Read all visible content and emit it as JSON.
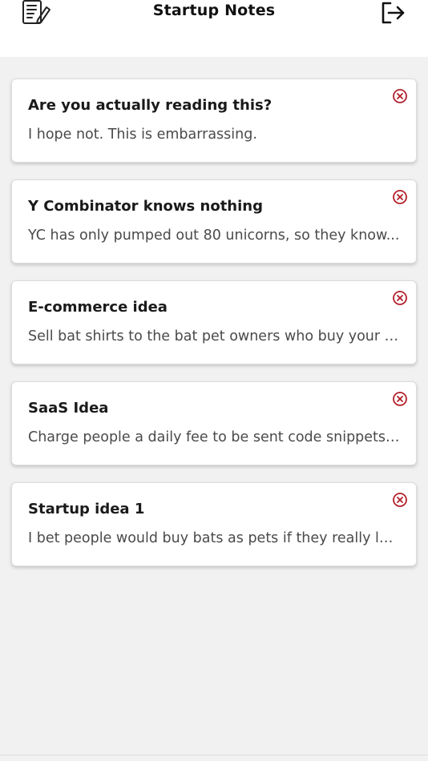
{
  "header": {
    "title": "Startup Notes",
    "logo_icon": "notepad-pencil-icon",
    "logout_icon": "logout-icon"
  },
  "notes": [
    {
      "title": "Are you actually reading this?",
      "body": "I hope not. This is embarrassing."
    },
    {
      "title": "Y Combinator knows nothing",
      "body": "YC has only pumped out 80 unicorns, so they know..."
    },
    {
      "title": "E-commerce idea",
      "body": "Sell bat shirts to the bat pet owners who buy your b..."
    },
    {
      "title": "SaaS Idea",
      "body": "Charge people a daily fee to be sent code snippets y..."
    },
    {
      "title": "Startup idea 1",
      "body": "I bet people would buy bats as pets if they really lear..."
    }
  ],
  "delete_icon": "close-circle-icon",
  "colors": {
    "delete_accent": "#b3202a",
    "background": "#f1f1f1",
    "card": "#ffffff"
  }
}
